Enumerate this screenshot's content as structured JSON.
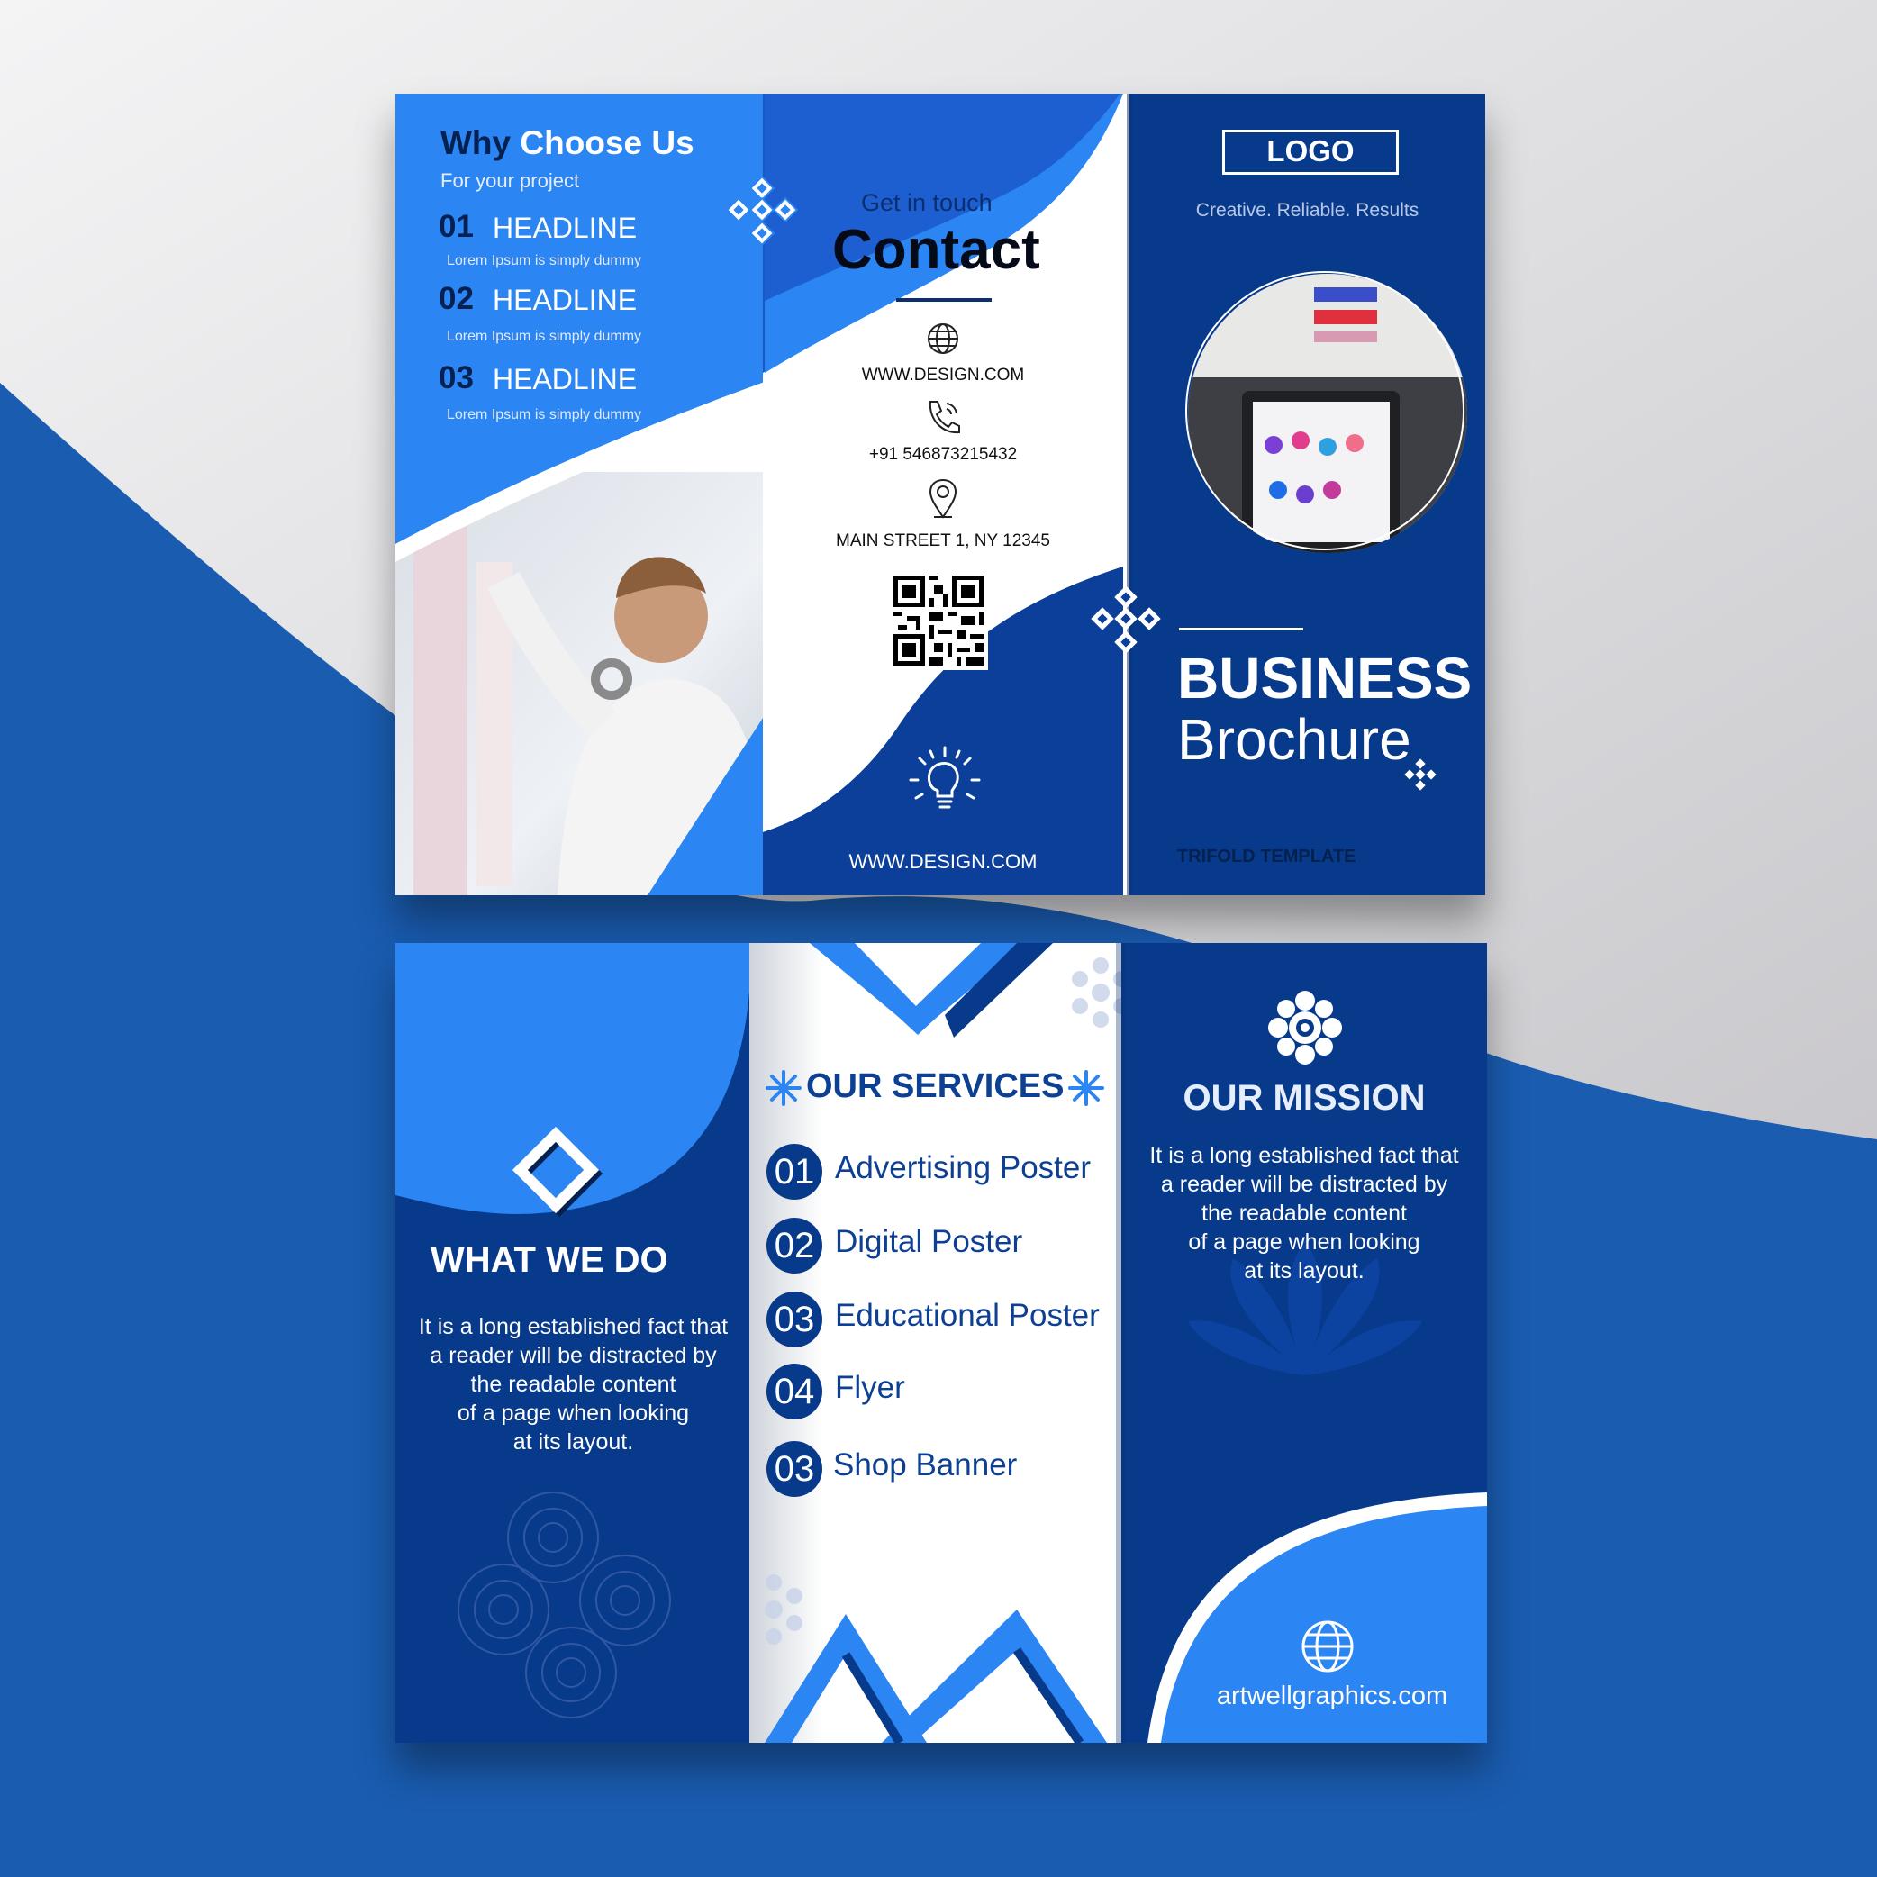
{
  "colors": {
    "dark_blue": "#073b92",
    "bright_blue": "#2b85f2",
    "navy": "#04204f",
    "white": "#ffffff",
    "bg_blue": "#1a5cb0",
    "bg_grey": "#d8d7da"
  },
  "outside": {
    "why": {
      "title_dark": "Why",
      "title_light": "Choose Us",
      "subtitle": "For your project"
    },
    "headlines": [
      {
        "num": "01",
        "label": "HEADLINE",
        "text": "Lorem Ipsum is simply dummy"
      },
      {
        "num": "02",
        "label": "HEADLINE",
        "text": "Lorem Ipsum is simply dummy"
      },
      {
        "num": "03",
        "label": "HEADLINE",
        "text": "Lorem Ipsum is simply dummy"
      }
    ],
    "contact": {
      "kicker": "Get in touch",
      "title": "Contact",
      "website": "WWW.DESIGN.COM",
      "phone": "+91 546873215432",
      "address": "MAIN STREET 1, NY 12345",
      "footer_website": "WWW.DESIGN.COM",
      "icons": [
        "globe-icon",
        "phone-icon",
        "location-pin-icon",
        "qr-code",
        "lightbulb-icon"
      ]
    },
    "cover": {
      "logo": "LOGO",
      "tagline": "Creative.  Reliable.  Results",
      "title_bold": "BUSINESS",
      "title_light": "Brochure",
      "template": "TRIFOLD TEMPLATE"
    }
  },
  "inside": {
    "what": {
      "title": "WHAT WE DO",
      "lines": [
        "It is a long established fact that",
        "a reader will be distracted by",
        "the readable content",
        "of a page when looking",
        "at its layout."
      ]
    },
    "services": {
      "title": "OUR SERVICES",
      "items": [
        {
          "num": "01",
          "label": "Advertising Poster"
        },
        {
          "num": "02",
          "label": "Digital Poster"
        },
        {
          "num": "03",
          "label": "Educational Poster"
        },
        {
          "num": "04",
          "label": "Flyer"
        },
        {
          "num": "03",
          "label": "Shop Banner"
        }
      ]
    },
    "mission": {
      "title": "OUR MISSION",
      "lines": [
        "It is a long established fact that",
        "a reader will be distracted by",
        "the readable content",
        "of a page when looking",
        "at its layout."
      ],
      "website": "artwellgraphics.com"
    }
  }
}
